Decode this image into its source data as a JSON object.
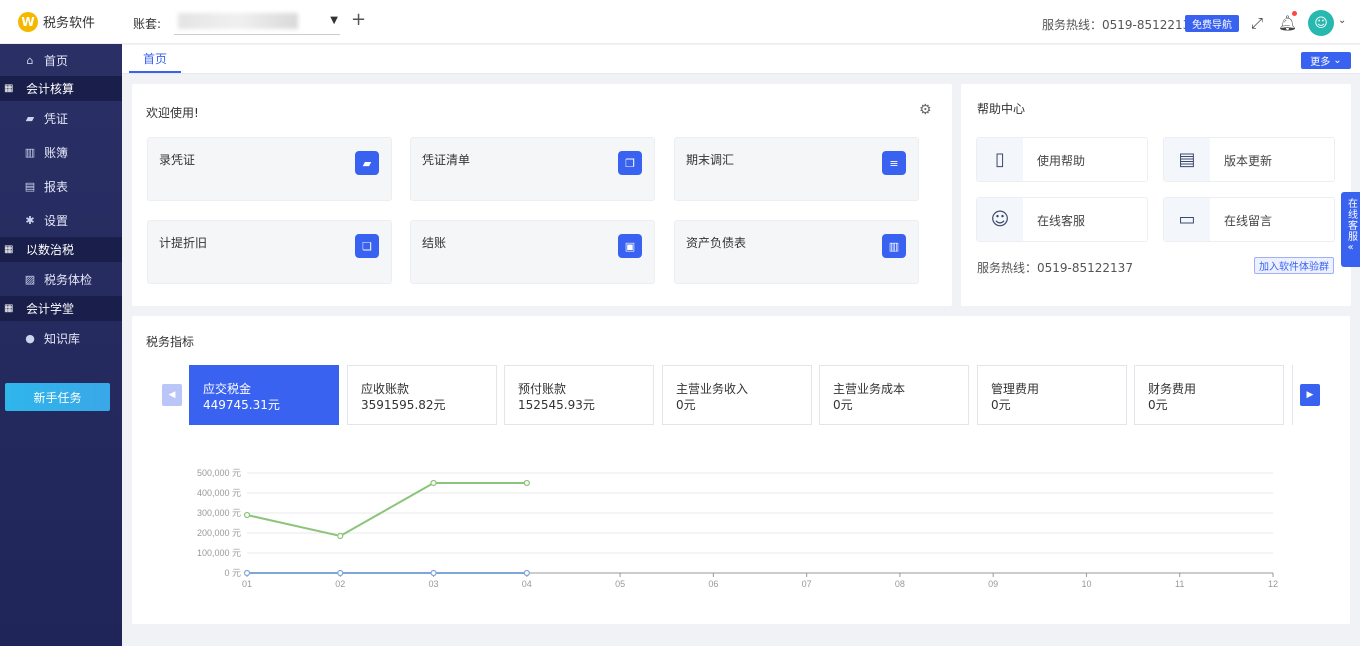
{
  "app": {
    "name": "税务软件"
  },
  "sidebar": {
    "home": "首页",
    "groups": [
      {
        "label": "会计核算",
        "items": [
          "凭证",
          "账簿",
          "报表",
          "设置"
        ]
      },
      {
        "label": "以数治税",
        "items": [
          "税务体检"
        ]
      },
      {
        "label": "会计学堂",
        "items": [
          "知识库"
        ]
      }
    ],
    "new_task": "新手任务"
  },
  "topbar": {
    "account_label": "账套:",
    "hotline": "服务热线：0519-85122137",
    "free_nav": "免费导航"
  },
  "tabs": {
    "home": "首页",
    "more": "更多"
  },
  "welcome": {
    "title": "欢迎使用!",
    "tiles": [
      {
        "label": "录凭证",
        "icon": "voucher-icon"
      },
      {
        "label": "凭证清单",
        "icon": "copy-icon"
      },
      {
        "label": "期末调汇",
        "icon": "database-icon"
      },
      {
        "label": "计提折旧",
        "icon": "stack-icon"
      },
      {
        "label": "结账",
        "icon": "checkout-icon"
      },
      {
        "label": "资产负债表",
        "icon": "bar-chart-icon"
      }
    ]
  },
  "help": {
    "title": "帮助中心",
    "items": [
      {
        "label": "使用帮助",
        "icon": "book-icon"
      },
      {
        "label": "版本更新",
        "icon": "doc-update-icon"
      },
      {
        "label": "在线客服",
        "icon": "agent-icon"
      },
      {
        "label": "在线留言",
        "icon": "message-icon"
      }
    ],
    "hotline": "服务热线：0519-85122137",
    "join": "加入软件体验群"
  },
  "side_service": {
    "label": "在线客服"
  },
  "tax": {
    "title": "税务指标",
    "metrics": [
      {
        "label": "应交税金",
        "value": "449745.31元"
      },
      {
        "label": "应收账款",
        "value": "3591595.82元"
      },
      {
        "label": "预付账款",
        "value": "152545.93元"
      },
      {
        "label": "主营业务收入",
        "value": "0元"
      },
      {
        "label": "主营业务成本",
        "value": "0元"
      },
      {
        "label": "管理费用",
        "value": "0元"
      },
      {
        "label": "财务费用",
        "value": "0元"
      }
    ]
  },
  "colors": {
    "accent": "#3a62f0",
    "sidebar": "#232a5e",
    "series_green": "#8bc47a",
    "series_blue": "#7ea6d6"
  },
  "chart_data": {
    "type": "line",
    "x": [
      "01",
      "02",
      "03",
      "04",
      "05",
      "06",
      "07",
      "08",
      "09",
      "10",
      "11",
      "12"
    ],
    "yticks": [
      "0 元",
      "100,000 元",
      "200,000 元",
      "300,000 元",
      "400,000 元",
      "500,000 元"
    ],
    "ylim": [
      0,
      500000
    ],
    "series": [
      {
        "values": [
          290000,
          185000,
          450000,
          450000
        ]
      },
      {
        "values": [
          0,
          0,
          0,
          0
        ]
      }
    ],
    "grid": true
  }
}
